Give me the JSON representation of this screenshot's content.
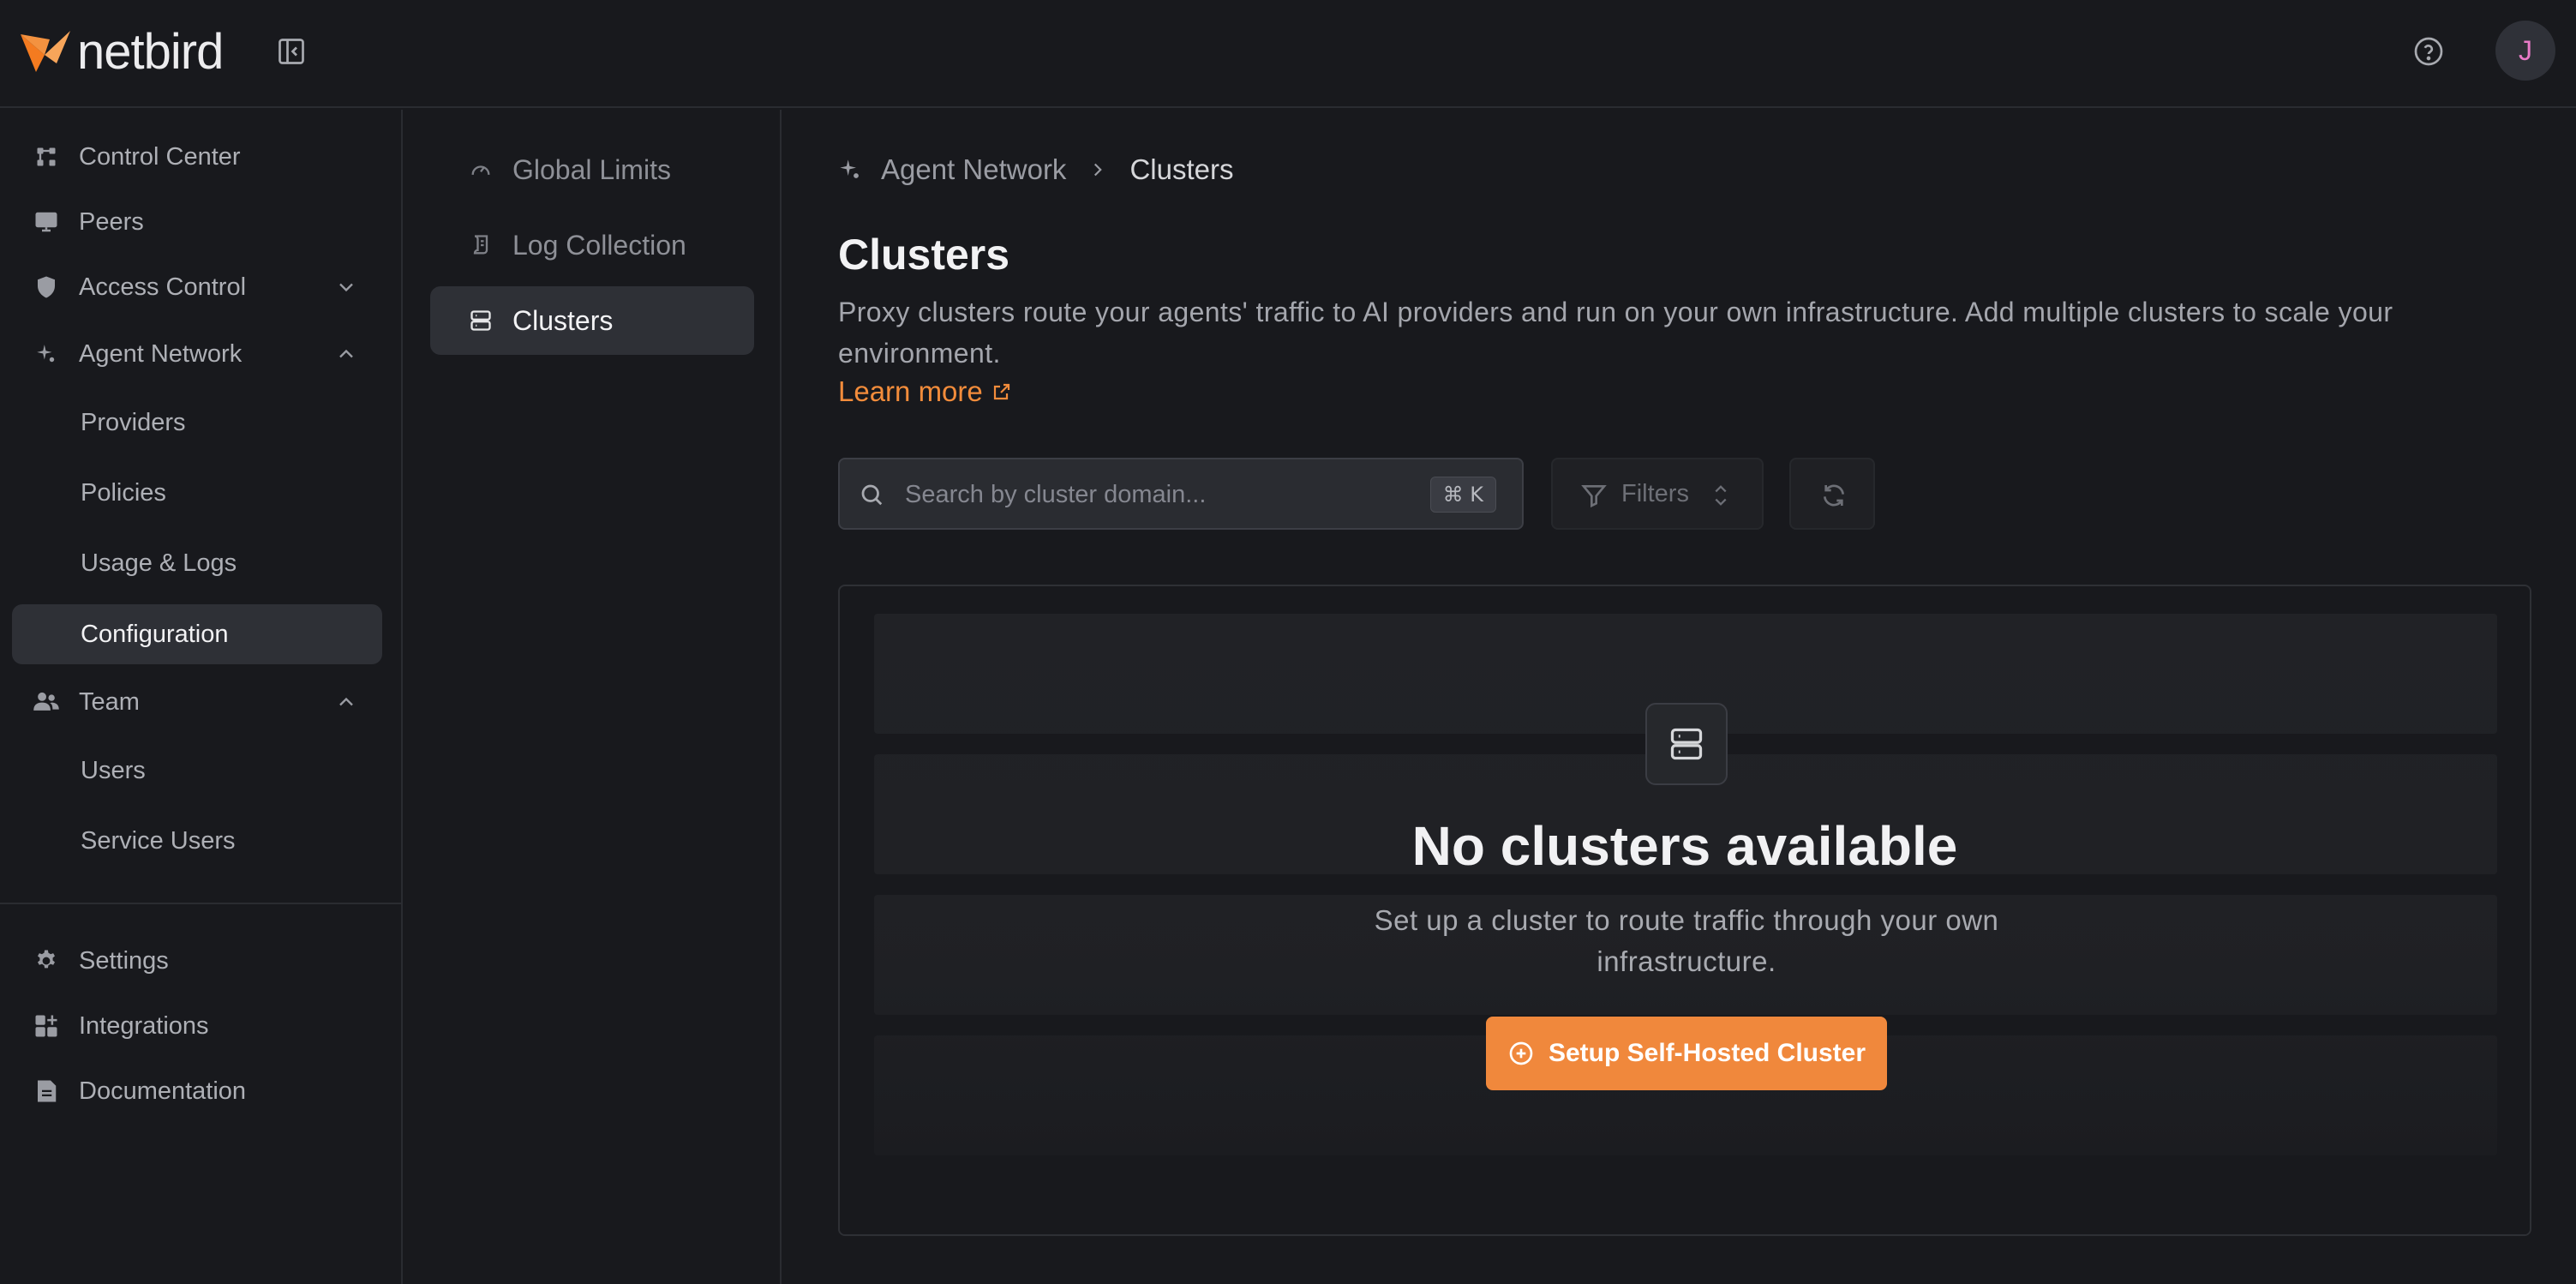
{
  "header": {
    "logo_text": "netbird",
    "avatar_initial": "J"
  },
  "sidebar": {
    "items": [
      {
        "label": "Control Center"
      },
      {
        "label": "Peers"
      },
      {
        "label": "Access Control"
      },
      {
        "label": "Agent Network"
      },
      {
        "label": "Providers"
      },
      {
        "label": "Policies"
      },
      {
        "label": "Usage & Logs"
      },
      {
        "label": "Configuration"
      },
      {
        "label": "Team"
      },
      {
        "label": "Users"
      },
      {
        "label": "Service Users"
      },
      {
        "label": "Settings"
      },
      {
        "label": "Integrations"
      },
      {
        "label": "Documentation"
      }
    ]
  },
  "subnav": {
    "items": [
      {
        "label": "Global Limits"
      },
      {
        "label": "Log Collection"
      },
      {
        "label": "Clusters"
      }
    ]
  },
  "main": {
    "breadcrumb": {
      "parent": "Agent Network",
      "current": "Clusters"
    },
    "title": "Clusters",
    "description": "Proxy clusters route your agents' traffic to AI providers and run on your own infrastructure. Add multiple clusters to scale your environment.",
    "learn_more": "Learn more",
    "search": {
      "placeholder": "Search by cluster domain...",
      "value": "",
      "shortcut": "⌘ K"
    },
    "filters_label": "Filters",
    "empty": {
      "title": "No clusters available",
      "description": "Set up a cluster to route traffic through your own infrastructure.",
      "button": "Setup Self-Hosted Cluster"
    }
  },
  "colors": {
    "background": "#18191d",
    "accent": "#f0883c",
    "active_item": "#2e3036",
    "avatar_text": "#e97bc8"
  }
}
